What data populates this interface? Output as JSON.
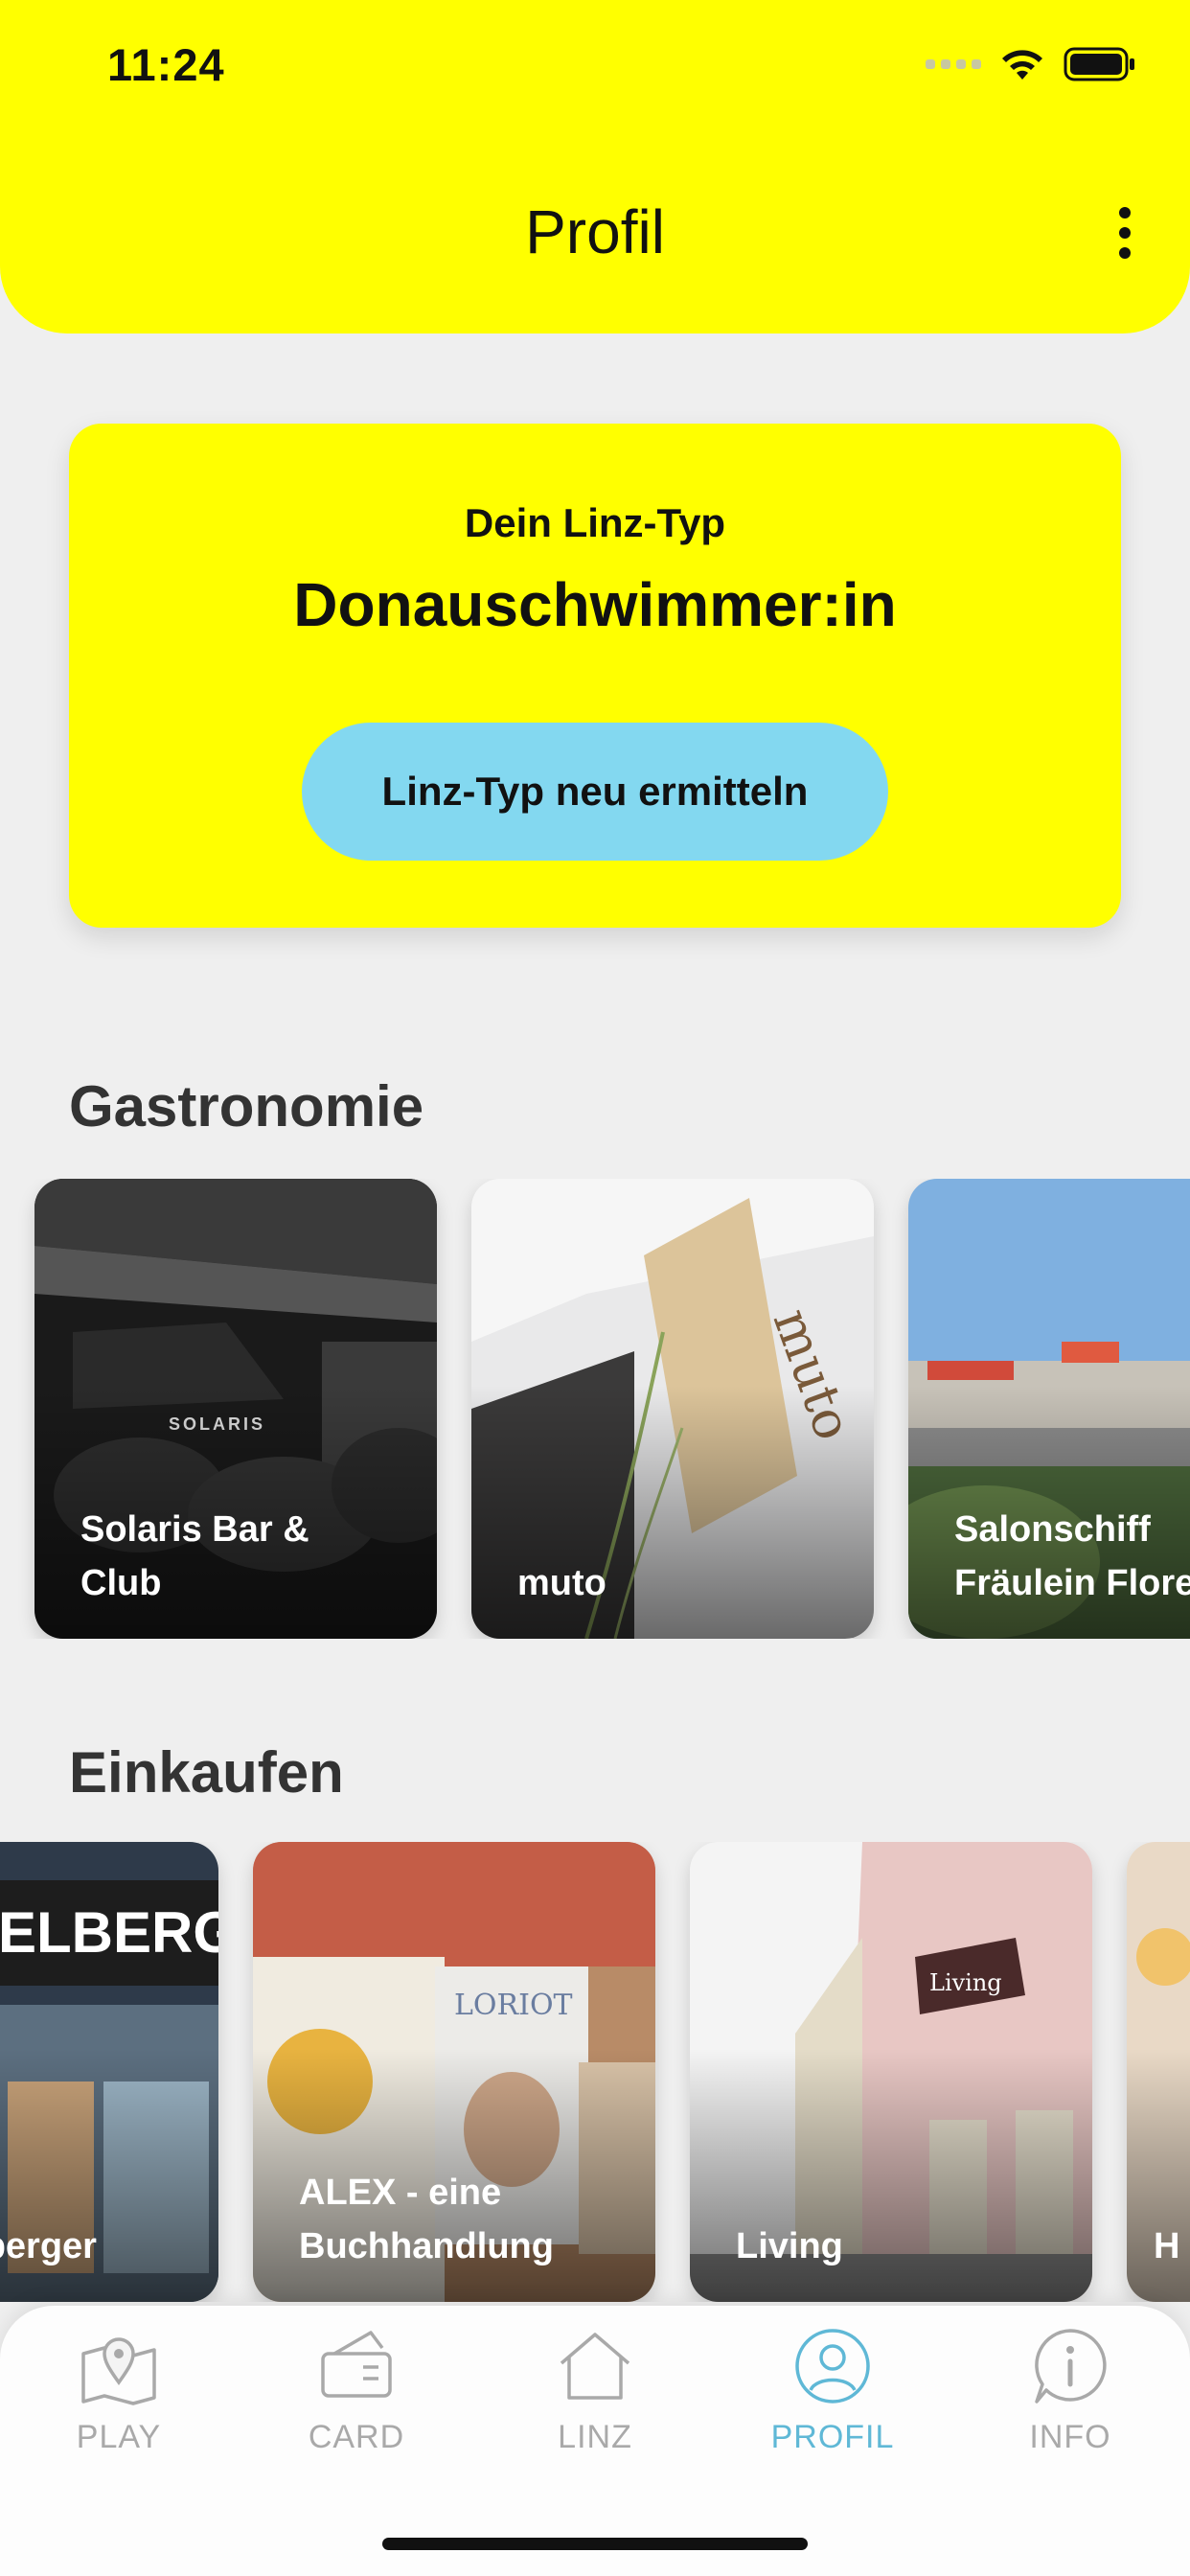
{
  "status_bar": {
    "time": "11:24"
  },
  "header": {
    "title": "Profil",
    "menu_icon": "more-vertical-icon"
  },
  "linz_type": {
    "label": "Dein Linz-Typ",
    "value": "Donauschwimmer:in",
    "button_label": "Linz-Typ neu ermitteln"
  },
  "sections": [
    {
      "title": "Gastronomie",
      "items": [
        {
          "label": "Solaris Bar &\nClub"
        },
        {
          "label": "muto"
        },
        {
          "label": "Salonschiff\nFräulein Flore"
        }
      ]
    },
    {
      "title": "Einkaufen",
      "items": [
        {
          "label": "Fürstelberger"
        },
        {
          "label": "ALEX - eine\nBuchhandlung"
        },
        {
          "label": "Living"
        },
        {
          "label": "H"
        }
      ]
    }
  ],
  "tabbar": {
    "tabs": [
      {
        "label": "PLAY",
        "icon": "map-pin-icon"
      },
      {
        "label": "CARD",
        "icon": "ticket-icon"
      },
      {
        "label": "LINZ",
        "icon": "home-icon"
      },
      {
        "label": "PROFIL",
        "icon": "user-icon",
        "active": true
      },
      {
        "label": "INFO",
        "icon": "info-icon"
      }
    ]
  },
  "colors": {
    "brand_yellow": "#ffff00",
    "accent_blue": "#83d8f0",
    "active_tab": "#5fb8d6"
  }
}
